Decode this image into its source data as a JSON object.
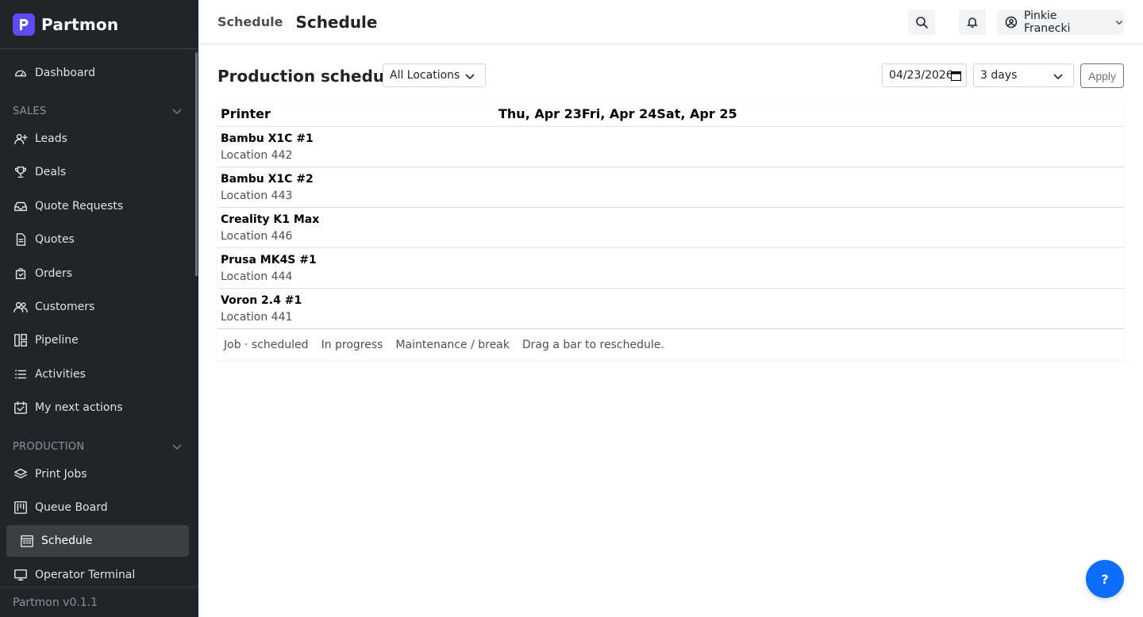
{
  "brand": {
    "name": "Partmon"
  },
  "sidebar": {
    "items": [
      {
        "label": "Dashboard",
        "icon": "dashboard-icon"
      },
      {
        "label": "Leads",
        "icon": "user-plus-icon"
      },
      {
        "label": "Deals",
        "icon": "trophy-icon"
      },
      {
        "label": "Quote Requests",
        "icon": "inbox-icon"
      },
      {
        "label": "Quotes",
        "icon": "document-icon"
      },
      {
        "label": "Orders",
        "icon": "bag-icon"
      },
      {
        "label": "Customers",
        "icon": "users-icon"
      },
      {
        "label": "Pipeline",
        "icon": "pipeline-icon"
      },
      {
        "label": "Activities",
        "icon": "list-icon"
      },
      {
        "label": "My next actions",
        "icon": "calendar-check-icon"
      },
      {
        "label": "Print Jobs",
        "icon": "layers-icon"
      },
      {
        "label": "Queue Board",
        "icon": "kanban-icon"
      },
      {
        "label": "Schedule",
        "icon": "calendar-grid-icon",
        "active": true
      },
      {
        "label": "Operator Terminal",
        "icon": "monitor-icon"
      }
    ],
    "sections": {
      "sales": "SALES",
      "production": "PRODUCTION"
    },
    "footer": "Partmon v0.1.1"
  },
  "header": {
    "breadcrumb": "Schedule",
    "title": "Schedule",
    "user": "Pinkie Franecki"
  },
  "toolbar": {
    "title": "Production schedule",
    "location_select": "All Locations",
    "date_value": "04/23/2026",
    "range_select": "3 days",
    "apply_label": "Apply"
  },
  "table": {
    "printer_header": "Printer",
    "days": [
      "Thu, Apr 23",
      "Fri, Apr 24",
      "Sat, Apr 25"
    ],
    "rows": [
      {
        "name": "Bambu X1C #1",
        "location": "Location 442"
      },
      {
        "name": "Bambu X1C #2",
        "location": "Location 443"
      },
      {
        "name": "Creality K1 Max",
        "location": "Location 446"
      },
      {
        "name": "Prusa MK4S #1",
        "location": "Location 444"
      },
      {
        "name": "Voron 2.4 #1",
        "location": "Location 441"
      }
    ]
  },
  "legend": {
    "items": [
      "Job · scheduled",
      "In progress",
      "Maintenance / break",
      "Drag a bar to reschedule."
    ]
  },
  "help": {
    "label": "?"
  },
  "colors": {
    "sidebar_bg": "#212529",
    "brand_logo": "#5b4cf5",
    "help_button": "#0d6efd"
  }
}
